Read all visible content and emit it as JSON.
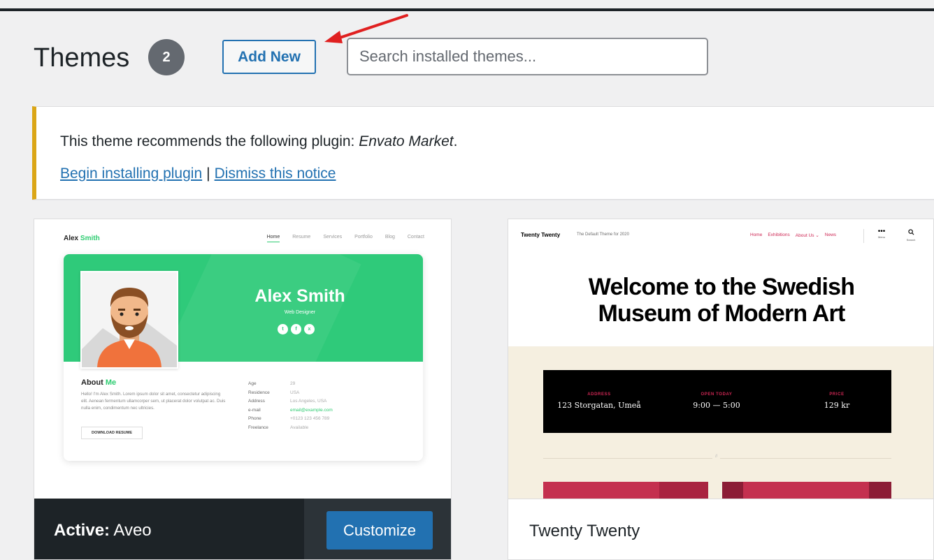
{
  "header": {
    "title": "Themes",
    "count": "2",
    "add_new_label": "Add New",
    "search_placeholder": "Search installed themes..."
  },
  "notice": {
    "text_prefix": "This theme recommends the following plugin: ",
    "plugin_name": "Envato Market",
    "text_suffix": ".",
    "begin_link": "Begin installing plugin",
    "separator": "|",
    "dismiss_link": "Dismiss this notice"
  },
  "colors": {
    "accent": "#2271b1",
    "notice_border": "#dba617",
    "arrow": "#e02020"
  },
  "themes": [
    {
      "name": "Aveo",
      "active_prefix": "Active:",
      "customize_label": "Customize",
      "screenshot": {
        "logo_first": "Alex ",
        "logo_second": "Smith",
        "nav": [
          "Home",
          "Resume",
          "Services",
          "Portfolio",
          "Blog",
          "Contact"
        ],
        "hero_name": "Alex Smith",
        "hero_role": "Web Designer",
        "social": [
          "t",
          "f",
          "x"
        ],
        "about_first": "About ",
        "about_second": "Me",
        "about_text": "Hello! I'm Alex Smith. Lorem ipsum dolor sit amet, consectetur adipiscing elit. Aenean fermentum ullamcorper sem, ut placerat dolor volutpat ac. Duis nulla enim, condimentum nec ultricies.",
        "download_label": "DOWNLOAD RESUME",
        "info": [
          {
            "k": "Age",
            "v": "29"
          },
          {
            "k": "Residence",
            "v": "USA"
          },
          {
            "k": "Address",
            "v": "Los Angeles, USA"
          },
          {
            "k": "e-mail",
            "v": "email@example.com"
          },
          {
            "k": "Phone",
            "v": "+0123 123 456 789"
          },
          {
            "k": "Freelance",
            "v": "Available"
          }
        ]
      }
    },
    {
      "name": "Twenty Twenty",
      "screenshot": {
        "logo": "Twenty Twenty",
        "tagline": "The Default Theme for 2020",
        "nav": [
          "Home",
          "Exhibitions",
          "About Us ⌄",
          "News"
        ],
        "menu_label": "Menu",
        "search_label": "Search",
        "headline": "Welcome to the Swedish Museum of Modern Art",
        "address_h": "ADDRESS",
        "address_v": "123 Storgatan, Umeå",
        "open_h": "OPEN TODAY",
        "open_v": "9:00 — 5:00",
        "price_h": "PRICE",
        "price_v": "129 kr",
        "sep_mark": "//"
      }
    }
  ]
}
